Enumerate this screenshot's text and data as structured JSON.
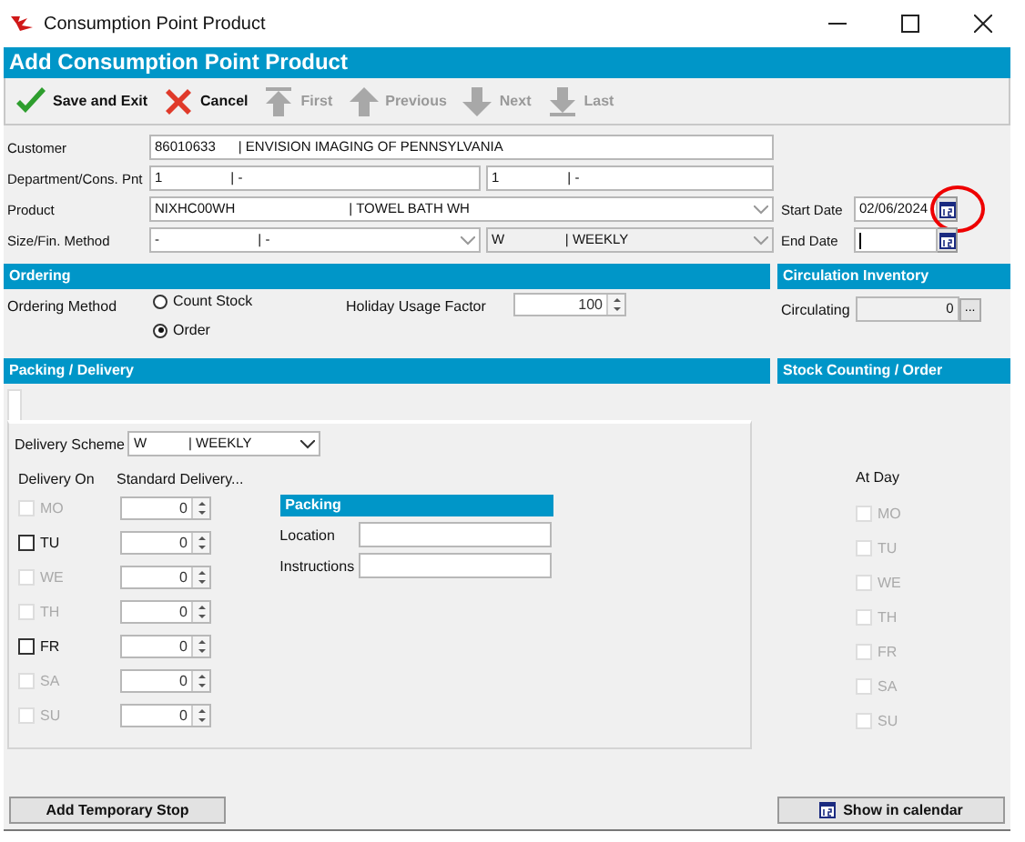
{
  "window": {
    "title": "Consumption Point Product"
  },
  "header": {
    "title": "Add Consumption Point Product"
  },
  "toolbar": [
    {
      "label": "Save and Exit",
      "kind": "check",
      "disabled": false
    },
    {
      "label": "Cancel",
      "kind": "cross",
      "disabled": false
    },
    {
      "label": "First",
      "kind": "first",
      "disabled": true
    },
    {
      "label": "Previous",
      "kind": "up",
      "disabled": true
    },
    {
      "label": "Next",
      "kind": "down",
      "disabled": true
    },
    {
      "label": "Last",
      "kind": "last",
      "disabled": true
    }
  ],
  "form": {
    "customer": {
      "label": "Customer",
      "value": "86010633      | ENVISION IMAGING OF PENNSYLVANIA"
    },
    "department": {
      "label": "Department/Cons. Pnt",
      "value1": "1                  | -",
      "value2": "1                  | -"
    },
    "product": {
      "label": "Product",
      "value": "NIXHC00WH                              | TOWEL BATH WH"
    },
    "size": {
      "label": "Size/Fin. Method",
      "value1": "-                          | -",
      "value2": "W                | WEEKLY"
    },
    "start_date": {
      "label": "Start Date",
      "value": "02/06/2024"
    },
    "end_date": {
      "label": "End Date"
    }
  },
  "ordering": {
    "title": "Ordering",
    "method_label": "Ordering Method",
    "options": [
      {
        "label": "Count Stock",
        "selected": false
      },
      {
        "label": "Order",
        "selected": true
      }
    ],
    "holiday_label": "Holiday Usage Factor",
    "holiday_value": "100"
  },
  "circulation": {
    "title": "Circulation Inventory",
    "label": "Circulating",
    "value": "0",
    "button": "..."
  },
  "packing_delivery": {
    "title": "Packing / Delivery",
    "scheme_label": "Delivery Scheme",
    "scheme_value": "W           | WEEKLY",
    "delivery_on_label": "Delivery On",
    "standard_label": "Standard Delivery...",
    "days": [
      {
        "label": "MO",
        "checked": false,
        "disabled": true,
        "value": "0"
      },
      {
        "label": "TU",
        "checked": false,
        "disabled": false,
        "value": "0"
      },
      {
        "label": "WE",
        "checked": false,
        "disabled": true,
        "value": "0"
      },
      {
        "label": "TH",
        "checked": false,
        "disabled": true,
        "value": "0"
      },
      {
        "label": "FR",
        "checked": false,
        "disabled": false,
        "value": "0"
      },
      {
        "label": "SA",
        "checked": false,
        "disabled": true,
        "value": "0"
      },
      {
        "label": "SU",
        "checked": false,
        "disabled": true,
        "value": "0"
      }
    ],
    "packing": {
      "title": "Packing",
      "location_label": "Location",
      "instructions_label": "Instructions"
    },
    "add_stop_button": "Add Temporary Stop"
  },
  "stock_counting": {
    "title": "Stock Counting / Order",
    "at_day_label": "At Day",
    "days": [
      {
        "label": "MO",
        "checked": false,
        "disabled": true
      },
      {
        "label": "TU",
        "checked": false,
        "disabled": true
      },
      {
        "label": "WE",
        "checked": false,
        "disabled": true
      },
      {
        "label": "TH",
        "checked": false,
        "disabled": true
      },
      {
        "label": "FR",
        "checked": false,
        "disabled": true
      },
      {
        "label": "SA",
        "checked": false,
        "disabled": true
      },
      {
        "label": "SU",
        "checked": false,
        "disabled": true
      }
    ],
    "calendar_button": "Show in calendar"
  }
}
